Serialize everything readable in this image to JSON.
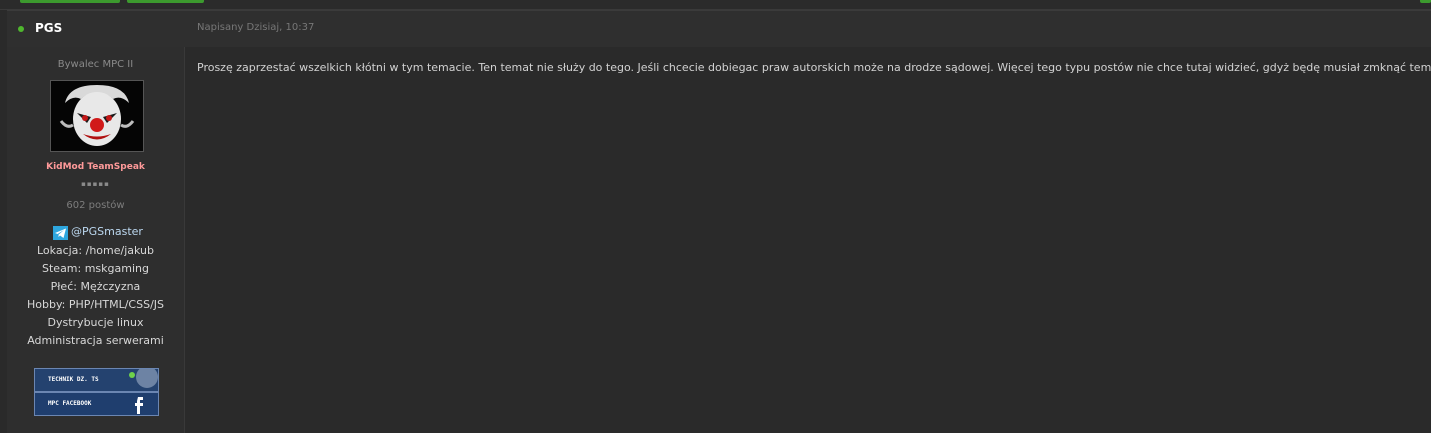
{
  "post": {
    "author": "PGS",
    "date": "Napisany Dzisiaj, 10:37",
    "body": "Proszę zaprzestać wszelkich kłótni w tym temacie. Ten temat nie służy do tego. Jeśli chcecie dobiegac praw autorskich może na drodze sądowej. Więcej tego typu postów nie chce tutaj widzieć, gdyż będę musiał zmknąć temat."
  },
  "profile": {
    "rank": "Bywalec MPC II",
    "group": "KidMod TeamSpeak",
    "pips": "▪▪▪▪▪",
    "post_count": "602 postów",
    "telegram": "@PGSmaster",
    "fields": [
      "Lokacja: /home/jakub",
      "Steam: mskgaming",
      "Płeć: Mężczyzna",
      "Hobby: PHP/HTML/CSS/JS",
      "Dystrybucje linux",
      "Administracja serwerami"
    ],
    "banners": [
      "TECHNIK DZ. TS",
      "MPC FACEBOOK"
    ]
  },
  "colors": {
    "online": "#4fb72e",
    "group": "#ff9a9a",
    "accent_green": "#3c9a2e",
    "telegram": "#2ea6de"
  },
  "icons": [
    "online-dot-icon",
    "telegram-icon",
    "facebook-icon",
    "clown-avatar"
  ]
}
